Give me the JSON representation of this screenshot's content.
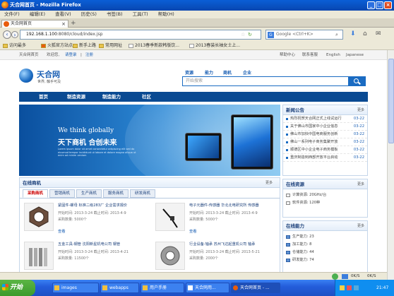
{
  "window": {
    "title": "天合网首页 - Mozilla Firefox"
  },
  "menu": [
    "文件(F)",
    "编辑(E)",
    "查看(V)",
    "历史(S)",
    "书签(B)",
    "工具(T)",
    "帮助(H)"
  ],
  "tab": {
    "label": "天合网首页"
  },
  "url": {
    "host": "192.168.1.100",
    "path": ":8080/cloud/index.jsp"
  },
  "search": {
    "placeholder": "Google <Ctrl+K>"
  },
  "bookmarks": [
    "访问最多",
    "火狐官方站点",
    "新手上路",
    "常用网址",
    "2013春季新款韩版饮...",
    "2013春装长袖女士上..."
  ],
  "site": {
    "topbar": {
      "welcome": "天合网首页",
      "hello": "欢迎您,",
      "login": "请登录",
      "sep": "|",
      "register": "注册",
      "right": [
        "帮助中心",
        "联系客服",
        "English",
        "Japanese"
      ]
    },
    "logo": {
      "name": "天合网",
      "slogan": "世界, 触手可及"
    },
    "topnav": [
      "资源",
      "能力",
      "商机",
      "企业"
    ],
    "search_placeholder": "开始搜索",
    "mainnav": [
      "首页",
      "制造资源",
      "制造能力",
      "社区"
    ],
    "banner": {
      "we": "We think globally",
      "cn": "天下商机  合创未来",
      "desc": "Lorem ipsum dolor sit amet consectetur adipiscing elit sed do eiusmod tempor incididunt ut labore et dolore magna aliqua ut enim ad minim veniam",
      "dots": [
        "1",
        "2",
        "3",
        "4",
        "5"
      ],
      "active_dot": "1"
    },
    "news": {
      "title": "新闻公告",
      "more": "更多",
      "items": [
        {
          "t": "热烈祝贺天合网正式上线试运行",
          "d": "03-22"
        },
        {
          "t": "关于佛山市国家中小企业信息",
          "d": "03-22"
        },
        {
          "t": "佛山市加快中国电商服务创新",
          "d": "03-22"
        },
        {
          "t": "佛山一系列电子商务集聚开放",
          "d": "03-22"
        },
        {
          "t": "顺德区中小企业电子商务模板",
          "d": "03-22"
        },
        {
          "t": "重庆制造到西部开放平台启动",
          "d": "03-22"
        }
      ]
    },
    "resources": {
      "title": "在线资源",
      "more": "更多",
      "items": [
        {
          "t": "计算资源: 20GHz/台"
        },
        {
          "t": "软件资源: 120种"
        }
      ]
    },
    "capability": {
      "title": "在线能力",
      "more": "更多",
      "items": [
        {
          "t": "生产能力: 23"
        },
        {
          "t": "加工能力: 8"
        },
        {
          "t": "仓储能力: 44"
        },
        {
          "t": "研发能力: 74"
        }
      ]
    },
    "opportunity": {
      "title": "在线商机",
      "more": "更多",
      "tabs": [
        "采购商机",
        "营销商机",
        "生产商机",
        "服务商机",
        "研发商机"
      ],
      "active_tab": "采购商机",
      "buy": "查看",
      "products": [
        {
          "title": "紧固件-螺母 标准二级283厂 企业需求报价",
          "line1": "开始时间: 2013-3-24  截止时间: 2013-4-9",
          "line2": "采购数量: 5000个"
        },
        {
          "title": "电子元器件-传感器 华北北电研究所 传感器",
          "line1": "开始时间: 2013-3-24  截止时间: 2013-4-9",
          "line2": "采购数量: 5000个"
        },
        {
          "title": "五金工具-钢管 沈阳新星机电公司 钢管",
          "line1": "开始时间: 2013-3-24  截止时间: 2013-4-21",
          "line2": "采购数量: 11500个"
        },
        {
          "title": "行业设备-轴承 苏州飞达起重机公司 轴承",
          "line1": "开始时间: 2013-3-24  截止时间: 2013-5-21",
          "line2": "采购数量: 2000个"
        }
      ]
    }
  },
  "taskbar": {
    "start": "开始",
    "items": [
      "images",
      "webapps",
      "用户手册",
      "天合网用...",
      "天合网首页 - ..."
    ],
    "tray": {
      "net": "0K/S",
      "net2": "0K/S",
      "time": "21:47"
    }
  },
  "colors": {
    "brand": "#1a5fb4",
    "nav": "#0a4a92",
    "accent": "#f0a020"
  }
}
